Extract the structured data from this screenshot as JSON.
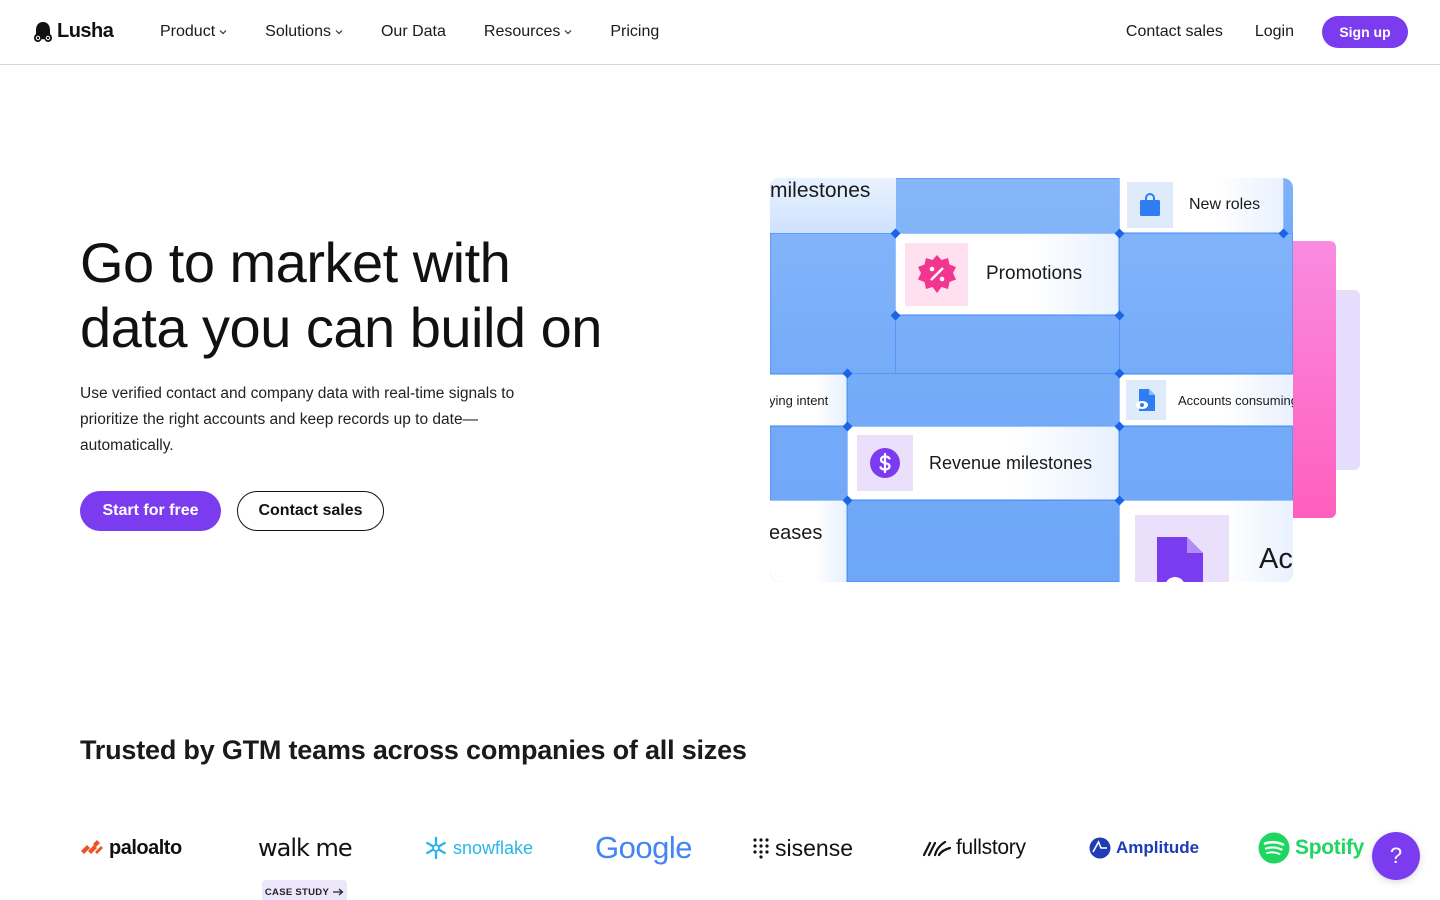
{
  "nav": {
    "logo_text": "Lusha",
    "items": [
      {
        "label": "Product",
        "has_dropdown": true
      },
      {
        "label": "Solutions",
        "has_dropdown": true
      },
      {
        "label": "Our Data",
        "has_dropdown": false
      },
      {
        "label": "Resources",
        "has_dropdown": true
      },
      {
        "label": "Pricing",
        "has_dropdown": false
      }
    ],
    "contact_sales": "Contact sales",
    "login": "Login",
    "signup": "Sign up"
  },
  "hero": {
    "title_line1": "Go to market with",
    "title_line2": "data you can build on",
    "subtitle": "Use verified contact and company data with real-time signals to prioritize the right accounts and keep records up to date—automatically.",
    "cta_primary": "Start for free",
    "cta_secondary": "Contact sales"
  },
  "illustration": {
    "labels": {
      "milestones": "milestones",
      "new_roles": "New roles",
      "promotions": "Promotions",
      "buying_intent": "ying intent",
      "accounts_consuming": "Accounts consuming",
      "revenue_milestones": "Revenue milestones",
      "releases": "eases",
      "ac": "Ac"
    },
    "icons": {
      "new_roles": "shopping-bag-icon",
      "promotions": "discount-badge-icon",
      "accounts_consuming": "document-eye-icon",
      "revenue_milestones": "dollar-circle-icon"
    },
    "colors": {
      "blue": "#5b9cf7",
      "pink": "#ff5fbd",
      "magenta": "#f2368f",
      "purple": "#7b3cf0"
    }
  },
  "trusted": {
    "heading": "Trusted by GTM teams across companies of all sizes",
    "logos": [
      "paloalto",
      "walk me",
      "snowflake",
      "Google",
      "sisense",
      "fullstory",
      "Amplitude",
      "Spotify"
    ],
    "case_study_label": "CASE STUDY"
  },
  "help": {
    "label": "?"
  },
  "colors": {
    "accent": "#7b3cf0"
  }
}
